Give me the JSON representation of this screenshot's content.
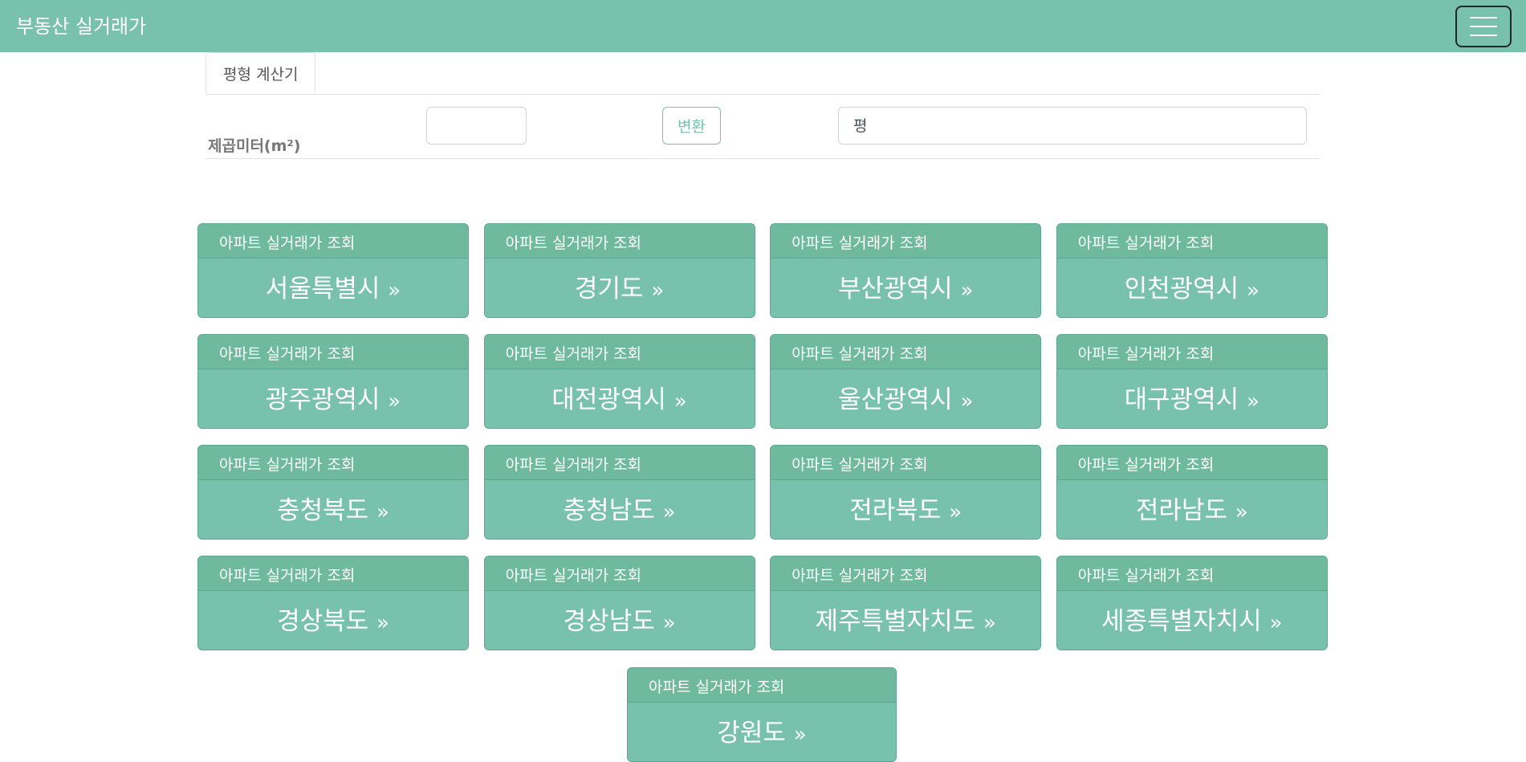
{
  "header": {
    "brand": "부동산 실거래가",
    "menu_icon": "hamburger-icon"
  },
  "colors": {
    "primary": "#78c2ad",
    "card_header": "#6fba9f",
    "text_on_primary": "#ffffff"
  },
  "calculator": {
    "tab_label": "평형 계산기",
    "field_label": "제곱미터(m²)",
    "sqm_value": "",
    "convert_label": "변환",
    "pyeong_placeholder": "평"
  },
  "region_cards": {
    "subtitle": "아파트 실거래가 조회",
    "arrow": "»",
    "regions": [
      "서울특별시",
      "경기도",
      "부산광역시",
      "인천광역시",
      "광주광역시",
      "대전광역시",
      "울산광역시",
      "대구광역시",
      "충청북도",
      "충청남도",
      "전라북도",
      "전라남도",
      "경상북도",
      "경상남도",
      "제주특별자치도",
      "세종특별자치시",
      "강원도"
    ]
  }
}
